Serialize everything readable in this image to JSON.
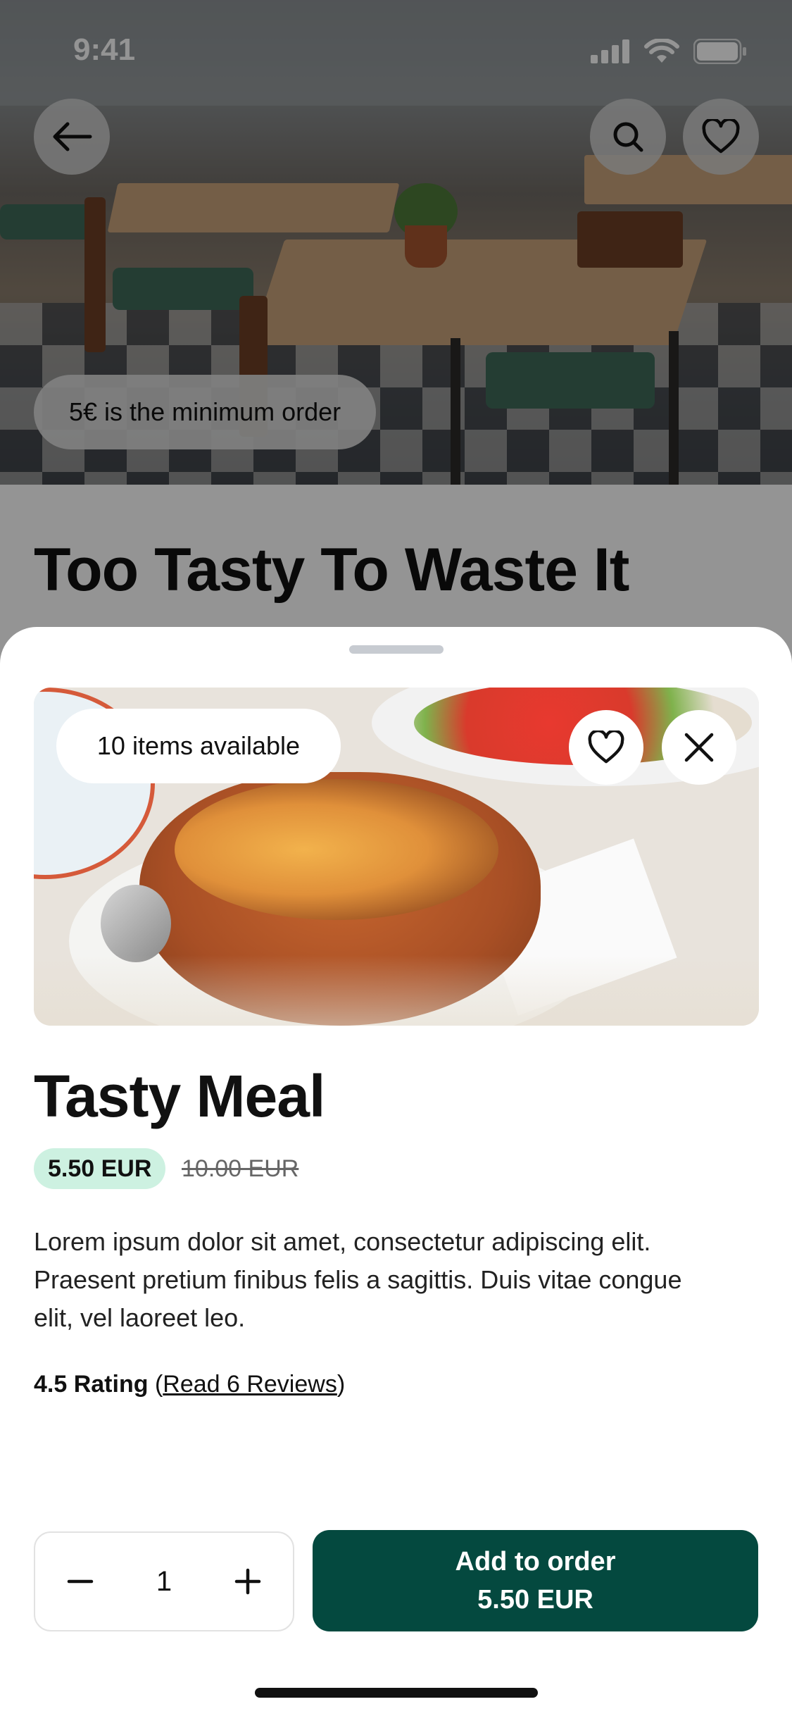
{
  "status_bar": {
    "time": "9:41"
  },
  "header": {
    "min_order": "5€ is the minimum order",
    "store_title": "Too Tasty To Waste It",
    "icons": {
      "back": "arrow-left-icon",
      "search": "search-icon",
      "favorite": "heart-icon"
    }
  },
  "sheet": {
    "availability": "10 items available",
    "meal_title": "Tasty Meal",
    "price": "5.50 EUR",
    "old_price": "10.00 EUR",
    "description": "Lorem ipsum dolor sit amet, consectetur adipiscing elit. Praesent pretium finibus felis a sagittis. Duis vitae congue elit, vel laoreet leo.",
    "rating_label": "4.5 Rating",
    "reviews_link": "Read 6 Reviews",
    "quantity": "1",
    "add_button": {
      "line1": "Add to order",
      "line2": "5.50 EUR"
    }
  },
  "colors": {
    "accent": "#04493f",
    "price_badge": "#cdf1e1"
  }
}
